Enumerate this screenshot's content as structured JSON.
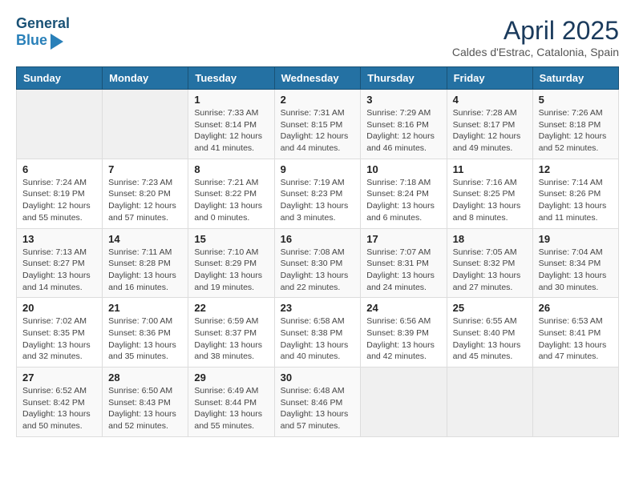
{
  "header": {
    "logo_line1": "General",
    "logo_line2": "Blue",
    "month_year": "April 2025",
    "location": "Caldes d'Estrac, Catalonia, Spain"
  },
  "days_of_week": [
    "Sunday",
    "Monday",
    "Tuesday",
    "Wednesday",
    "Thursday",
    "Friday",
    "Saturday"
  ],
  "weeks": [
    [
      {
        "day": "",
        "info": ""
      },
      {
        "day": "",
        "info": ""
      },
      {
        "day": "1",
        "info": "Sunrise: 7:33 AM\nSunset: 8:14 PM\nDaylight: 12 hours and 41 minutes."
      },
      {
        "day": "2",
        "info": "Sunrise: 7:31 AM\nSunset: 8:15 PM\nDaylight: 12 hours and 44 minutes."
      },
      {
        "day": "3",
        "info": "Sunrise: 7:29 AM\nSunset: 8:16 PM\nDaylight: 12 hours and 46 minutes."
      },
      {
        "day": "4",
        "info": "Sunrise: 7:28 AM\nSunset: 8:17 PM\nDaylight: 12 hours and 49 minutes."
      },
      {
        "day": "5",
        "info": "Sunrise: 7:26 AM\nSunset: 8:18 PM\nDaylight: 12 hours and 52 minutes."
      }
    ],
    [
      {
        "day": "6",
        "info": "Sunrise: 7:24 AM\nSunset: 8:19 PM\nDaylight: 12 hours and 55 minutes."
      },
      {
        "day": "7",
        "info": "Sunrise: 7:23 AM\nSunset: 8:20 PM\nDaylight: 12 hours and 57 minutes."
      },
      {
        "day": "8",
        "info": "Sunrise: 7:21 AM\nSunset: 8:22 PM\nDaylight: 13 hours and 0 minutes."
      },
      {
        "day": "9",
        "info": "Sunrise: 7:19 AM\nSunset: 8:23 PM\nDaylight: 13 hours and 3 minutes."
      },
      {
        "day": "10",
        "info": "Sunrise: 7:18 AM\nSunset: 8:24 PM\nDaylight: 13 hours and 6 minutes."
      },
      {
        "day": "11",
        "info": "Sunrise: 7:16 AM\nSunset: 8:25 PM\nDaylight: 13 hours and 8 minutes."
      },
      {
        "day": "12",
        "info": "Sunrise: 7:14 AM\nSunset: 8:26 PM\nDaylight: 13 hours and 11 minutes."
      }
    ],
    [
      {
        "day": "13",
        "info": "Sunrise: 7:13 AM\nSunset: 8:27 PM\nDaylight: 13 hours and 14 minutes."
      },
      {
        "day": "14",
        "info": "Sunrise: 7:11 AM\nSunset: 8:28 PM\nDaylight: 13 hours and 16 minutes."
      },
      {
        "day": "15",
        "info": "Sunrise: 7:10 AM\nSunset: 8:29 PM\nDaylight: 13 hours and 19 minutes."
      },
      {
        "day": "16",
        "info": "Sunrise: 7:08 AM\nSunset: 8:30 PM\nDaylight: 13 hours and 22 minutes."
      },
      {
        "day": "17",
        "info": "Sunrise: 7:07 AM\nSunset: 8:31 PM\nDaylight: 13 hours and 24 minutes."
      },
      {
        "day": "18",
        "info": "Sunrise: 7:05 AM\nSunset: 8:32 PM\nDaylight: 13 hours and 27 minutes."
      },
      {
        "day": "19",
        "info": "Sunrise: 7:04 AM\nSunset: 8:34 PM\nDaylight: 13 hours and 30 minutes."
      }
    ],
    [
      {
        "day": "20",
        "info": "Sunrise: 7:02 AM\nSunset: 8:35 PM\nDaylight: 13 hours and 32 minutes."
      },
      {
        "day": "21",
        "info": "Sunrise: 7:00 AM\nSunset: 8:36 PM\nDaylight: 13 hours and 35 minutes."
      },
      {
        "day": "22",
        "info": "Sunrise: 6:59 AM\nSunset: 8:37 PM\nDaylight: 13 hours and 38 minutes."
      },
      {
        "day": "23",
        "info": "Sunrise: 6:58 AM\nSunset: 8:38 PM\nDaylight: 13 hours and 40 minutes."
      },
      {
        "day": "24",
        "info": "Sunrise: 6:56 AM\nSunset: 8:39 PM\nDaylight: 13 hours and 42 minutes."
      },
      {
        "day": "25",
        "info": "Sunrise: 6:55 AM\nSunset: 8:40 PM\nDaylight: 13 hours and 45 minutes."
      },
      {
        "day": "26",
        "info": "Sunrise: 6:53 AM\nSunset: 8:41 PM\nDaylight: 13 hours and 47 minutes."
      }
    ],
    [
      {
        "day": "27",
        "info": "Sunrise: 6:52 AM\nSunset: 8:42 PM\nDaylight: 13 hours and 50 minutes."
      },
      {
        "day": "28",
        "info": "Sunrise: 6:50 AM\nSunset: 8:43 PM\nDaylight: 13 hours and 52 minutes."
      },
      {
        "day": "29",
        "info": "Sunrise: 6:49 AM\nSunset: 8:44 PM\nDaylight: 13 hours and 55 minutes."
      },
      {
        "day": "30",
        "info": "Sunrise: 6:48 AM\nSunset: 8:46 PM\nDaylight: 13 hours and 57 minutes."
      },
      {
        "day": "",
        "info": ""
      },
      {
        "day": "",
        "info": ""
      },
      {
        "day": "",
        "info": ""
      }
    ]
  ]
}
